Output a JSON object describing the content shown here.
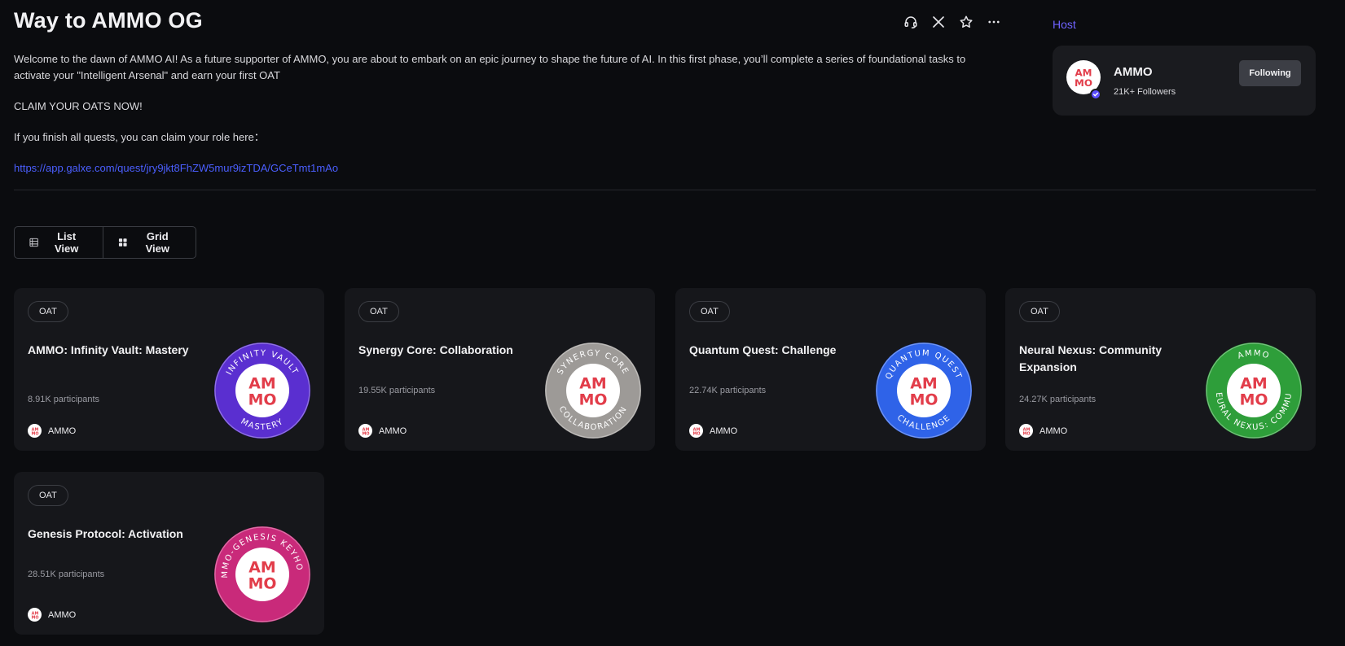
{
  "header": {
    "title": "Way to AMMO OG",
    "actions": [
      {
        "name": "headset-icon"
      },
      {
        "name": "x-twitter-icon"
      },
      {
        "name": "star-icon"
      },
      {
        "name": "more-icon"
      }
    ]
  },
  "description": {
    "line1": "Welcome to the dawn of AMMO AI! As a future supporter of AMMO, you are about to embark on an epic journey to shape the future of AI. In this first phase, you’ll complete a series of foundational tasks to",
    "line2": "activate your \"Intelligent Arsenal\" and earn your first OAT",
    "claim": "CLAIM YOUR OATS NOW!",
    "role_text": "If you finish all quests, you can claim your role here：",
    "role_link": "https://app.galxe.com/quest/jry9jkt8FhZW5mur9izTDA/GCeTmt1mAo"
  },
  "host": {
    "label": "Host",
    "name": "AMMO",
    "followers": "21K+ Followers",
    "follow_button": "Following"
  },
  "view_toggle": {
    "list": "List View",
    "grid": "Grid View"
  },
  "logo_text": {
    "top": "AM",
    "bottom": "MO"
  },
  "cards": [
    {
      "badge": "OAT",
      "title": "AMMO: Infinity Vault: Mastery",
      "participants": "8.91K participants",
      "org": "AMMO",
      "ring_top": "INFINITY VAULT",
      "ring_bottom": "MASTERY",
      "color": "#5a2fd0"
    },
    {
      "badge": "OAT",
      "title": "Synergy Core: Collaboration",
      "participants": "19.55K participants",
      "org": "AMMO",
      "ring_top": "SYNERGY CORE",
      "ring_bottom": "COLLABORATION",
      "color": "#9d9a97"
    },
    {
      "badge": "OAT",
      "title": "Quantum Quest: Challenge",
      "participants": "22.74K participants",
      "org": "AMMO",
      "ring_top": "QUANTUM QUEST",
      "ring_bottom": "CHALLENGE",
      "color": "#2f63e8"
    },
    {
      "badge": "OAT",
      "title": "Neural Nexus: Community Expansion",
      "participants": "24.27K participants",
      "org": "AMMO",
      "ring_top": "AMMO",
      "ring_bottom": "NEURAL NEXUS: COMMUN",
      "color": "#2e9e3a"
    },
    {
      "badge": "OAT",
      "title": "Genesis Protocol: Activation",
      "participants": "28.51K participants",
      "org": "AMMO",
      "ring_top": "AMMO-GENESIS KEYHOLD",
      "ring_bottom": "",
      "color": "#c92a7a"
    }
  ]
}
